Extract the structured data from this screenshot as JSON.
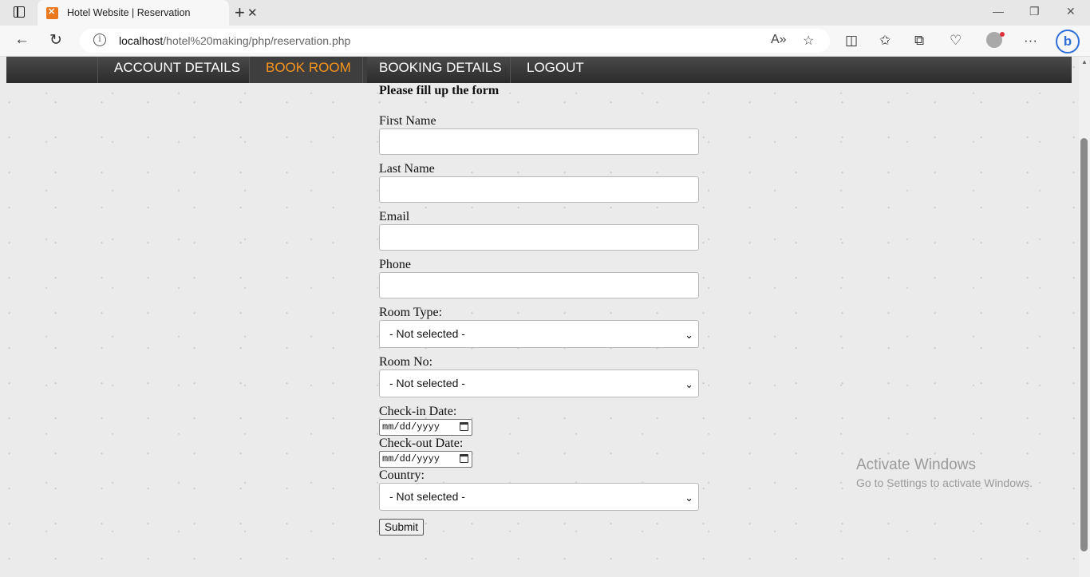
{
  "browser": {
    "tab_title": "Hotel Website | Reservation",
    "url_host": "localhost",
    "url_path": "/hotel%20making/php/reservation.php"
  },
  "nav": {
    "items": [
      {
        "label": "ACCOUNT DETAILS",
        "active": false
      },
      {
        "label": "BOOK ROOM",
        "active": true
      },
      {
        "label": "BOOKING DETAILS",
        "active": false
      },
      {
        "label": "LOGOUT",
        "active": false
      }
    ],
    "active_color": "#f7941d"
  },
  "form": {
    "heading": "Please fill up the form",
    "first_name_label": "First Name",
    "last_name_label": "Last Name",
    "email_label": "Email",
    "phone_label": "Phone",
    "room_type_label": "Room Type:",
    "room_type_value": "- Not selected -",
    "room_no_label": "Room No:",
    "room_no_value": "- Not selected -",
    "checkin_label": "Check-in Date:",
    "checkin_value": "mm/dd/yyyy",
    "checkout_label": "Check-out Date:",
    "checkout_value": "mm/dd/yyyy",
    "country_label": "Country:",
    "country_value": "- Not selected -",
    "submit_label": "Submit"
  },
  "watermark": {
    "line1": "Activate Windows",
    "line2": "Go to Settings to activate Windows."
  }
}
